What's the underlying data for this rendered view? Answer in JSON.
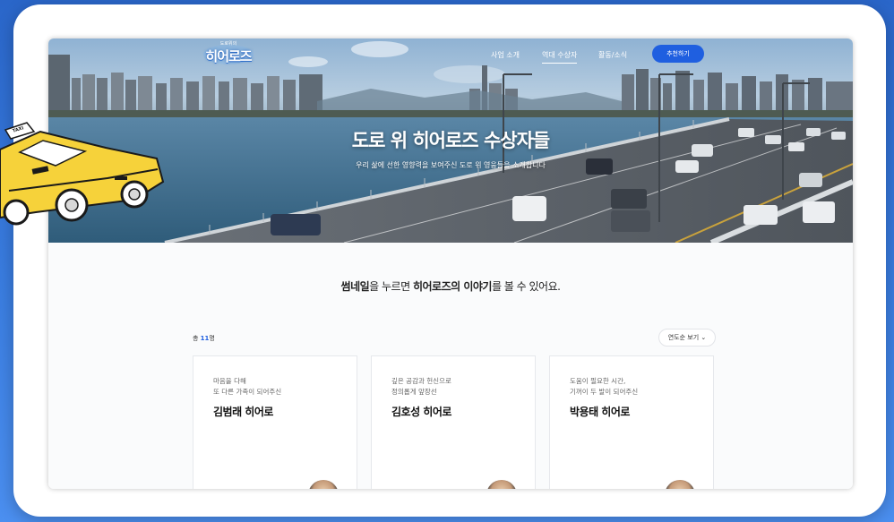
{
  "nav": {
    "logo_small": "도로위의",
    "logo": "히어로즈",
    "links": [
      "사업 소개",
      "역대 수상자",
      "활동/소식"
    ],
    "cta": "추천하기"
  },
  "taxi": {
    "sign": "TAXI"
  },
  "hero": {
    "title": "도로 위 히어로즈 수상자들",
    "subtitle": "우리 삶에 선한 영향력을 보여주신 도로 위 영웅들을 소개합니다"
  },
  "intro": {
    "p1": "썸네일",
    "p2": "을 누르면 ",
    "p3": "히어로즈의 이야기",
    "p4": "를 볼 수 있어요."
  },
  "list": {
    "count_prefix": "총 ",
    "count_num": "11",
    "count_suffix": "명",
    "sort_label": "연도순 보기 ⌄"
  },
  "cards": [
    {
      "line1": "마음을 다해",
      "line2": "또 다른 가족이 되어주신",
      "name": "김범래 히어로"
    },
    {
      "line1": "깊은 공감과 헌신으로",
      "line2": "정의롭게 앞장선",
      "name": "김호성 히어로"
    },
    {
      "line1": "도움이 필요한 시간,",
      "line2": "기꺼이 두 발이 되어주신",
      "name": "박용태 히어로"
    }
  ],
  "colors": {
    "accent": "#1f5fe0",
    "taxi": "#f6d23a",
    "background": "#3a7de0"
  }
}
